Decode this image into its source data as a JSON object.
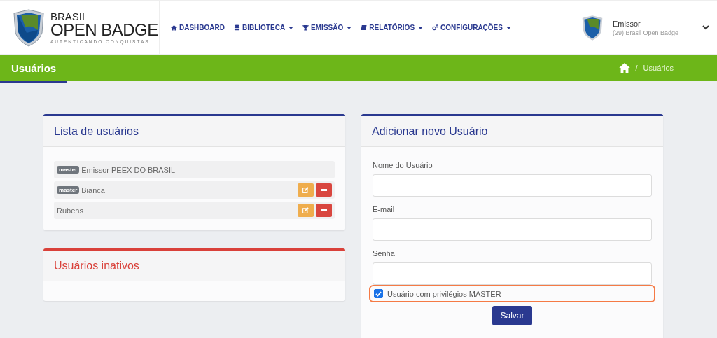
{
  "header": {
    "logo": {
      "line1": "BRASIL",
      "line2": "OPEN BADGE",
      "tagline": "AUTENTICANDO CONQUISTAS"
    },
    "nav": [
      {
        "label": "DASHBOARD",
        "dropdown": false
      },
      {
        "label": "BIBLIOTECA",
        "dropdown": true
      },
      {
        "label": "EMISSÃO",
        "dropdown": true
      },
      {
        "label": "RELATÓRIOS",
        "dropdown": true
      },
      {
        "label": "CONFIGURAÇÕES",
        "dropdown": true
      }
    ],
    "user": {
      "name": "Emissor",
      "org": "(29) Brasil Open Badge"
    }
  },
  "page_bar": {
    "title": "Usuários",
    "breadcrumb": {
      "separator": "/",
      "current": "Usuários"
    }
  },
  "users_card": {
    "title": "Lista de usuários",
    "users": [
      {
        "name": "Emissor PEEX DO BRASIL",
        "badge": "master",
        "actions": false
      },
      {
        "name": "Bianca",
        "badge": "master",
        "actions": true
      },
      {
        "name": "Rubens",
        "actions": true
      }
    ]
  },
  "inactive_card": {
    "title": "Usuários inativos"
  },
  "form_card": {
    "title": "Adicionar novo Usuário",
    "fields": [
      {
        "label": "Nome do Usuário"
      },
      {
        "label": "E-mail"
      },
      {
        "label": "Senha"
      }
    ],
    "master_checkbox": {
      "label": "Usuário com privilégios MASTER",
      "checked": true,
      "highlighted": true
    },
    "submit": "Salvar"
  }
}
